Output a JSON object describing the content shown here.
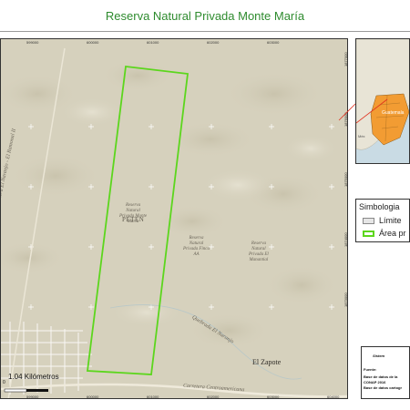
{
  "title": "Reserva Natural Privada Monte María",
  "map": {
    "x_ticks": [
      "599000",
      "600000",
      "601000",
      "602000",
      "603000",
      "604000"
    ],
    "y_ticks": [
      "1877000",
      "1876000",
      "1875000",
      "1874000",
      "1873000"
    ],
    "roads": {
      "naranjo": "Carretera El Naranjo - El Ramonal II",
      "centroamericana": "Carretera Centroamericana"
    },
    "labels": {
      "peten": "PETEN",
      "monte_maria": [
        "Reserva",
        "Natural",
        "Privada Monte",
        "María"
      ],
      "finca_aa": [
        "Reserva",
        "Natural",
        "Privada Finca",
        "AA"
      ],
      "manantial": [
        "Reserva",
        "Natural",
        "Privada El",
        "Manantial"
      ],
      "quebrada": "Quebrada El Naranjo",
      "town": "El Zapote"
    },
    "scale_bar": "1.04 Kilómetros",
    "scale_zero": "0"
  },
  "inset": {
    "country_label": "Guatemala",
    "neighbor_label": "Méx"
  },
  "legend": {
    "title": "Simbologia",
    "items": [
      {
        "label": "Límite",
        "swatch_fill": "#e6e6e6",
        "swatch_border": "#888888"
      },
      {
        "label": "Área pr",
        "swatch_fill": "#ffffff",
        "swatch_border": "#5cd61d"
      }
    ]
  },
  "info": {
    "heading": "Sistem",
    "fuente": "Fuente:",
    "lines": [
      "Base de datos de la",
      "CONAP 2016",
      "Base de datos cartogr"
    ]
  },
  "colors": {
    "title": "#2e8b2e",
    "boundary": "#5cd61d",
    "terrain": "#d6d1bd",
    "inset_line": "#e0301e"
  }
}
